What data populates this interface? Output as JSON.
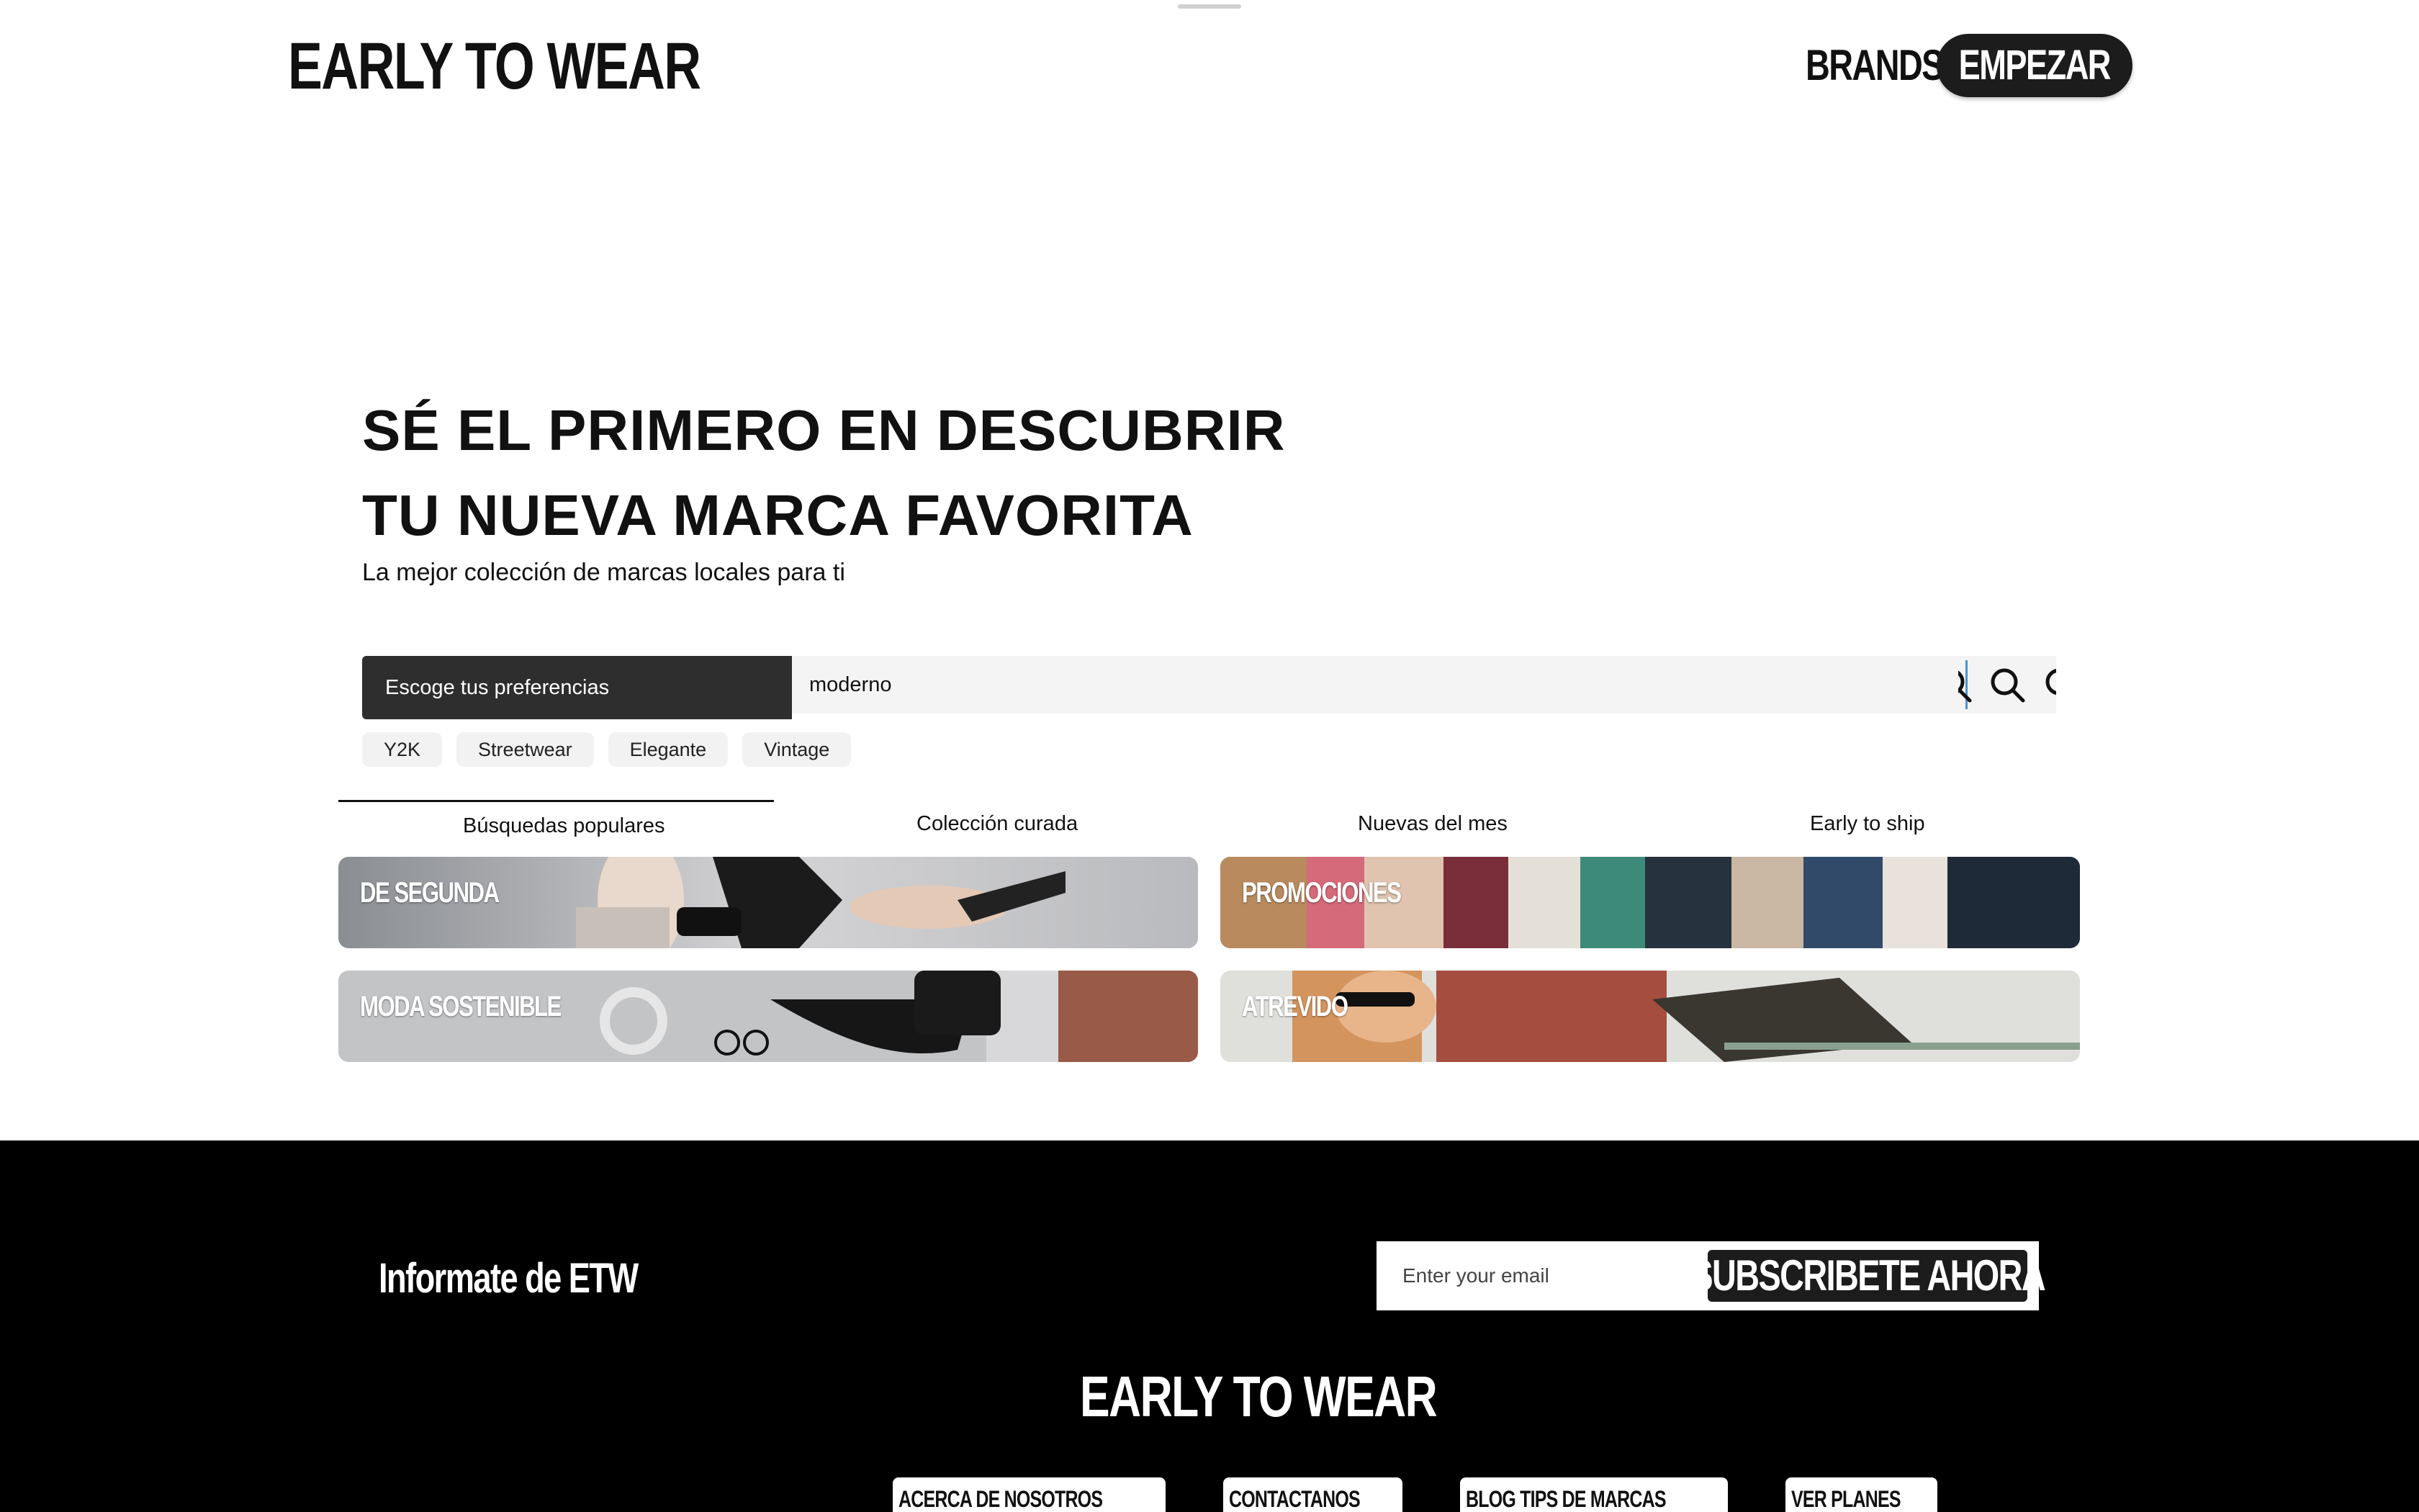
{
  "header": {
    "logo": "EARLY TO WEAR",
    "nav_brands": "BRANDS",
    "nav_start": "EMPEZAR"
  },
  "hero": {
    "title_line1": "SÉ EL PRIMERO EN DESCUBRIR",
    "title_line2": "TU NUEVA MARCA FAVORITA",
    "subtitle": "La mejor colección de marcas locales para ti"
  },
  "search": {
    "preferences_label": "Escoge tus preferencias",
    "value": "moderno",
    "icon": "search-icon",
    "chips": [
      "Y2K",
      "Streetwear",
      "Elegante",
      "Vintage"
    ]
  },
  "tabs": [
    {
      "label": "Búsquedas populares",
      "active": true
    },
    {
      "label": "Colección curada",
      "active": false
    },
    {
      "label": "Nuevas del mes",
      "active": false
    },
    {
      "label": "Early to ship",
      "active": false
    }
  ],
  "cards": [
    {
      "label": "DE SEGUNDA"
    },
    {
      "label": "PROMOCIONES"
    },
    {
      "label": "MODA SOSTENIBLE"
    },
    {
      "label": "ATREVIDO"
    }
  ],
  "footer": {
    "title": "Informate de ETW",
    "email_placeholder": "Enter your email",
    "subscribe_label": "SUBSCRIBETE AHORA",
    "logo": "EARLY TO WEAR",
    "links": [
      "ACERCA DE NOSOTROS",
      "CONTACTANOS",
      "BLOG TIPS DE MARCAS",
      "VER PLANES"
    ]
  },
  "colors": {
    "primary": "#1c1c1c",
    "footer_bg": "#000000",
    "search_bg": "#f4f4f4",
    "chip_bg": "#f2f2f2"
  }
}
